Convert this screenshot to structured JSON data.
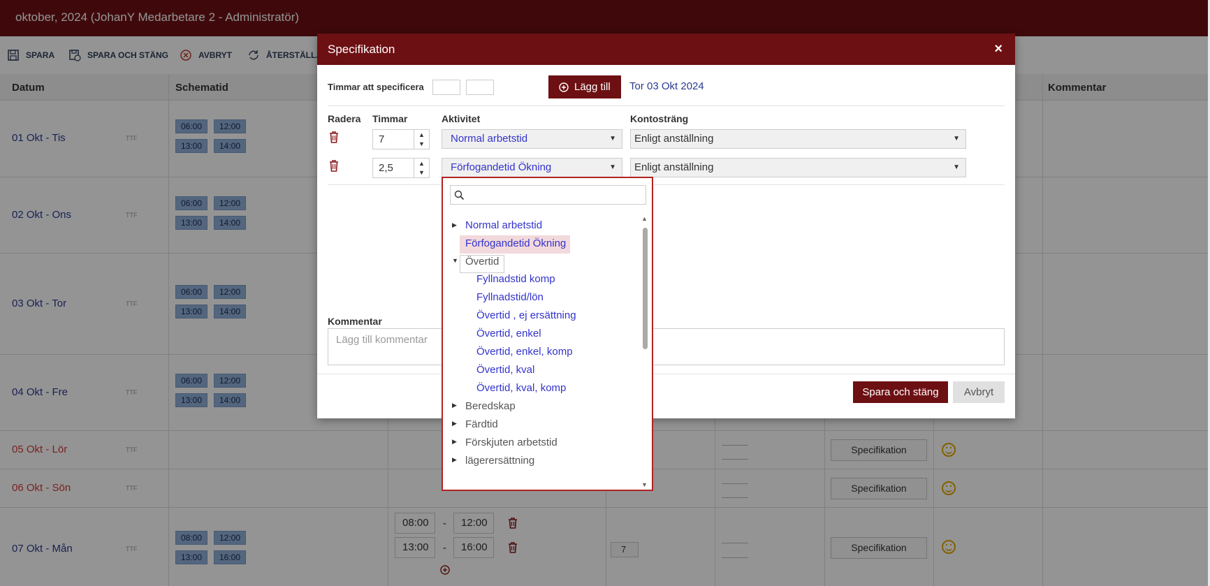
{
  "window": {
    "title": "oktober, 2024 (JohanY Medarbetare 2 - Administratör)"
  },
  "toolbar": {
    "save": "SPARA",
    "save_close": "SPARA OCH STÄNG",
    "cancel": "AVBRYT",
    "reset": "ÅTERSTÄLLA S"
  },
  "grid": {
    "headers": {
      "datum": "Datum",
      "schematid": "Schematid",
      "kommentar": "Kommentar"
    },
    "rows": [
      {
        "date": "01 Okt - Tis",
        "ttf": "TTF",
        "times": [
          "06:00",
          "12:00",
          "13:00",
          "14:00"
        ]
      },
      {
        "date": "02 Okt - Ons",
        "ttf": "TTF",
        "times": [
          "06:00",
          "12:00",
          "13:00",
          "14:00"
        ]
      },
      {
        "date": "03 Okt - Tor",
        "ttf": "TTF",
        "times": [
          "06:00",
          "12:00",
          "13:00",
          "14:00"
        ]
      },
      {
        "date": "04 Okt - Fre",
        "ttf": "TTF",
        "times": [
          "06:00",
          "12:00",
          "13:00",
          "14:00"
        ]
      },
      {
        "date": "05 Okt - Lör",
        "ttf": "TTF",
        "spec": "Specifikation"
      },
      {
        "date": "06 Okt - Sön",
        "ttf": "TTF",
        "spec": "Specifikation"
      },
      {
        "date": "07 Okt - Mån",
        "ttf": "TTF",
        "times": [
          "08:00",
          "12:00",
          "13:00",
          "16:00"
        ],
        "inputs": [
          "08:00",
          "12:00",
          "13:00",
          "16:00"
        ],
        "separator": "-",
        "hours": "7",
        "spec": "Specifikation"
      }
    ]
  },
  "modal": {
    "title": "Specifikation",
    "close": "×",
    "hours_to_specify_label": "Timmar att specificera",
    "add_button": "Lägg till",
    "date_link": "Tor 03 Okt 2024",
    "col_radera": "Radera",
    "col_timmar": "Timmar",
    "col_aktivitet": "Aktivitet",
    "col_kontostrang": "Kontosträng",
    "lines": [
      {
        "hours": "7",
        "activity": "Normal arbetstid",
        "account": "Enligt anställning"
      },
      {
        "hours": "2,5",
        "activity": "Förfogandetid Ökning",
        "account": "Enligt anställning"
      }
    ],
    "comment_label": "Kommentar",
    "comment_placeholder": "Lägg till kommentar",
    "save_close": "Spara och stäng",
    "cancel": "Avbryt"
  },
  "dropdown": {
    "search_value": "",
    "items": [
      {
        "label": "Normal arbetstid",
        "kind": "group",
        "state": "collapsed"
      },
      {
        "label": "Förfogandetid Ökning",
        "kind": "leaf",
        "state": "selected"
      },
      {
        "label": "Övertid",
        "kind": "group",
        "state": "expanded"
      },
      {
        "label": "Fyllnadstid komp",
        "kind": "child"
      },
      {
        "label": "Fyllnadstid/lön",
        "kind": "child"
      },
      {
        "label": "Övertid , ej ersättning",
        "kind": "child"
      },
      {
        "label": "Övertid, enkel",
        "kind": "child"
      },
      {
        "label": "Övertid, enkel, komp",
        "kind": "child"
      },
      {
        "label": "Övertid, kval",
        "kind": "child"
      },
      {
        "label": "Övertid, kval, komp",
        "kind": "child"
      },
      {
        "label": "Beredskap",
        "kind": "group",
        "state": "collapsed"
      },
      {
        "label": "Färdtid",
        "kind": "group",
        "state": "collapsed"
      },
      {
        "label": "Förskjuten arbetstid",
        "kind": "group",
        "state": "collapsed"
      },
      {
        "label": "lägerersättning",
        "kind": "group",
        "state": "collapsed"
      }
    ]
  },
  "colors": {
    "brand": "#6d1013",
    "link": "#3333cc",
    "chip": "#8fb0d9",
    "weekend": "#d33a3a",
    "selected_bg": "#f2d9dc"
  }
}
